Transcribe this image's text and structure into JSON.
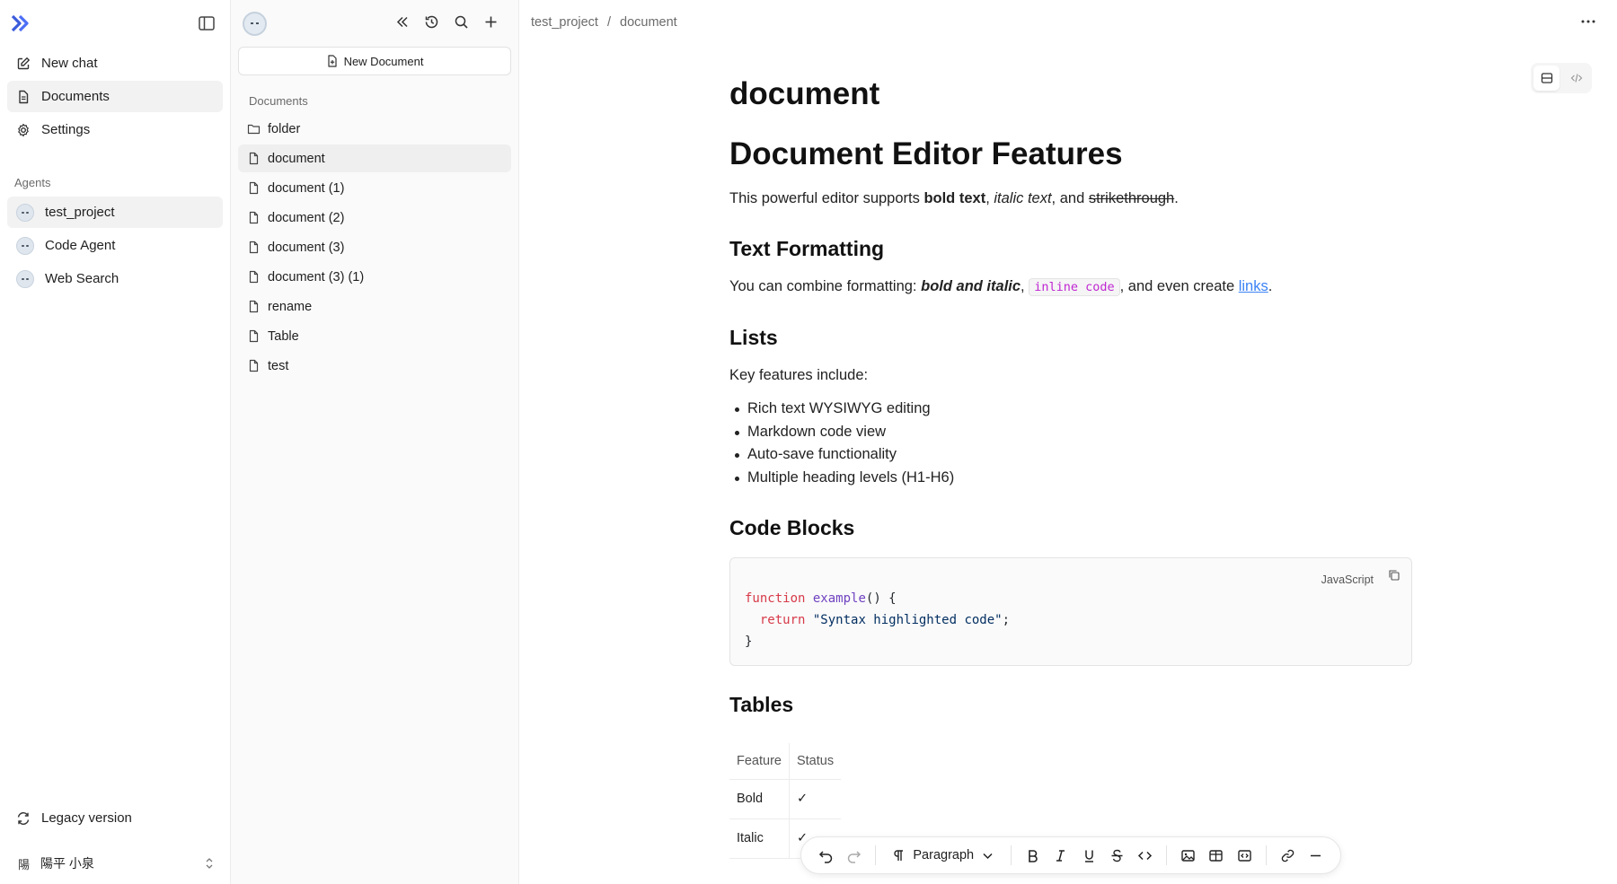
{
  "sidebar": {
    "nav": [
      {
        "label": "New chat",
        "icon": "edit-icon"
      },
      {
        "label": "Documents",
        "icon": "document-icon"
      },
      {
        "label": "Settings",
        "icon": "gear-icon"
      }
    ],
    "agents_label": "Agents",
    "agents": [
      {
        "label": "test_project"
      },
      {
        "label": "Code Agent"
      },
      {
        "label": "Web Search"
      }
    ],
    "legacy_label": "Legacy version",
    "user": {
      "initial": "陽",
      "name": "陽平 小泉"
    }
  },
  "docpanel": {
    "new_document_label": "New Document",
    "section_label": "Documents",
    "items": [
      {
        "label": "folder",
        "icon": "folder-icon"
      },
      {
        "label": "document",
        "icon": "file-icon"
      },
      {
        "label": "document (1)",
        "icon": "file-icon"
      },
      {
        "label": "document (2)",
        "icon": "file-icon"
      },
      {
        "label": "document (3)",
        "icon": "file-icon"
      },
      {
        "label": "document (3) (1)",
        "icon": "file-icon"
      },
      {
        "label": "rename",
        "icon": "file-icon"
      },
      {
        "label": "Table",
        "icon": "file-icon"
      },
      {
        "label": "test",
        "icon": "file-icon"
      }
    ]
  },
  "main": {
    "breadcrumb": [
      "test_project",
      "/",
      "document"
    ],
    "doc_title": "document",
    "h1": "Document Editor Features",
    "intro": {
      "prefix": "This powerful editor supports ",
      "bold": "bold text",
      "sep1": ", ",
      "italic": "italic text",
      "sep2": ", and ",
      "strike": "strikethrough",
      "end": "."
    },
    "h2_formatting": "Text Formatting",
    "formatting": {
      "prefix": "You can combine formatting: ",
      "bold_italic": "bold and italic",
      "sep1": ", ",
      "code": "inline code",
      "sep2": ", and even create ",
      "link": "links",
      "end": "."
    },
    "h2_lists": "Lists",
    "list_intro": "Key features include:",
    "list_items": [
      "Rich text WYSIWYG editing",
      "Markdown code view",
      "Auto-save functionality",
      "Multiple heading levels (H1-H6)"
    ],
    "h2_code": "Code Blocks",
    "code": {
      "lang": "JavaScript",
      "kw1": "function",
      "fn": "example",
      "p1": "() {",
      "kw2": "return",
      "str": "\"Syntax highlighted code\"",
      "p2": ";",
      "p3": "}"
    },
    "h2_tables": "Tables",
    "table": {
      "headers": [
        "Feature",
        "Status"
      ],
      "rows": [
        [
          "Bold",
          "✓"
        ],
        [
          "Italic",
          "✓"
        ]
      ]
    },
    "toolbar": {
      "paragraph_label": "Paragraph"
    }
  }
}
